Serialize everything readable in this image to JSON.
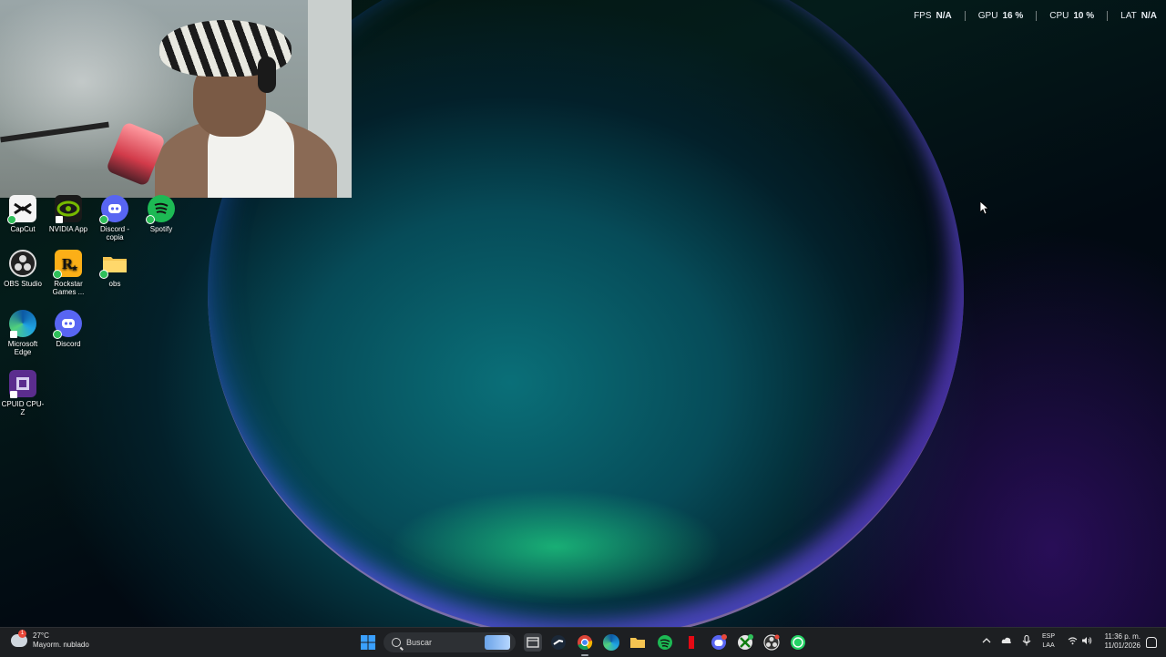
{
  "overlay": {
    "stats": [
      {
        "label": "FPS",
        "value": "N/A"
      },
      {
        "label": "GPU",
        "value": "16 %"
      },
      {
        "label": "CPU",
        "value": "10 %"
      },
      {
        "label": "LAT",
        "value": "N/A"
      }
    ]
  },
  "desktop": {
    "icons": [
      {
        "label": "CapCut",
        "icon": "capcut-icon"
      },
      {
        "label": "NVIDIA App",
        "icon": "nvidia-icon"
      },
      {
        "label": "Discord - copia",
        "icon": "discord-icon"
      },
      {
        "label": "Spotify",
        "icon": "spotify-icon"
      },
      {
        "label": "OBS Studio",
        "icon": "obs-icon"
      },
      {
        "label": "Rockstar Games ...",
        "icon": "rockstar-icon"
      },
      {
        "label": "obs",
        "icon": "folder-icon"
      },
      {
        "label": "Microsoft Edge",
        "icon": "edge-icon"
      },
      {
        "label": "Discord",
        "icon": "discord-icon"
      },
      {
        "label": "CPUID CPU-Z",
        "icon": "cpuz-icon"
      }
    ]
  },
  "taskbar": {
    "weather": {
      "temp": "27°C",
      "desc": "Mayorm. nublado",
      "badge": "1"
    },
    "search_placeholder": "Buscar",
    "apps": [
      "file-explorer-icon",
      "steam-icon",
      "chrome-icon",
      "edge-icon",
      "folder-icon",
      "spotify-icon",
      "netflix-icon",
      "discord-icon",
      "xbox-icon",
      "obs-icon",
      "whatsapp-icon"
    ],
    "lang": {
      "line1": "ESP",
      "line2": "LAA"
    },
    "time": "11:36 p. m.",
    "date": "11/01/2026"
  },
  "colors": {
    "taskbar_bg": "#1d1f22",
    "accent_blue": "#0078d4"
  }
}
